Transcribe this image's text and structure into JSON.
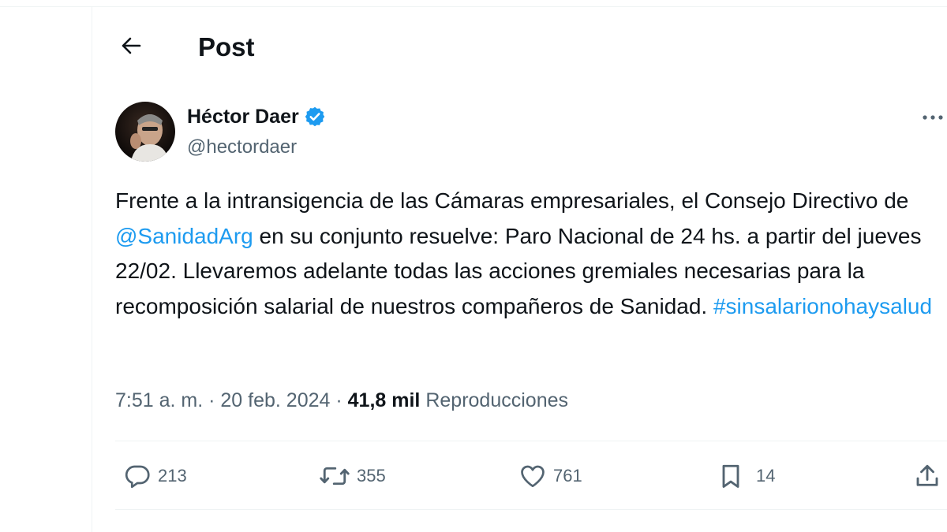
{
  "header": {
    "title": "Post",
    "back_icon": "arrow-left-icon"
  },
  "author": {
    "name": "Héctor Daer",
    "handle": "@hectordaer",
    "verified": true,
    "verified_color": "#1d9bf0"
  },
  "tweet": {
    "text_parts": {
      "p1": "Frente a la intransigencia de las Cámaras empresariales, el Consejo Directivo de ",
      "mention": "@SanidadArg",
      "p2": " en su conjunto resuelve: Paro Nacional de 24 hs. a partir del jueves 22/02. Llevaremos adelante todas las acciones gremiales necesarias para la recomposición salarial de nuestros compañeros de Sanidad. ",
      "hashtag": "#sinsalarionohaysalud"
    },
    "time": "7:51 a. m.",
    "separator": "·",
    "date": "20 feb. 2024",
    "views_count": "41,8 mil",
    "views_label": "Reproducciones"
  },
  "actions": {
    "replies": "213",
    "reposts": "355",
    "likes": "761",
    "bookmarks": "14"
  },
  "colors": {
    "link": "#1d9bf0",
    "secondary_text": "#536471",
    "primary_text": "#0f1419"
  }
}
